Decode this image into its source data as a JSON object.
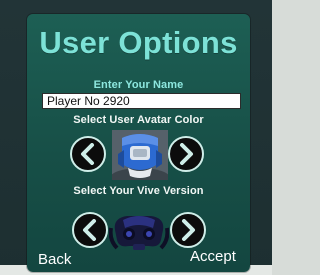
{
  "panel": {
    "title": "User Options",
    "name_label": "Enter Your Name",
    "name_value": "Player No 2920",
    "avatar_label": "Select User Avatar Color",
    "vive_label": "Select Your Vive Version",
    "back_label": "Back",
    "accept_label": "Accept"
  },
  "colors": {
    "panel_bg": "#1d5f54",
    "title_color": "#7de2d7",
    "arrow_button_bg": "#0c0c0c",
    "avatar_color": "#2c6ad1"
  },
  "icons": {
    "avatar_prev": "chevron-left-icon",
    "avatar_next": "chevron-right-icon",
    "vive_prev": "chevron-left-icon",
    "vive_next": "chevron-right-icon"
  }
}
